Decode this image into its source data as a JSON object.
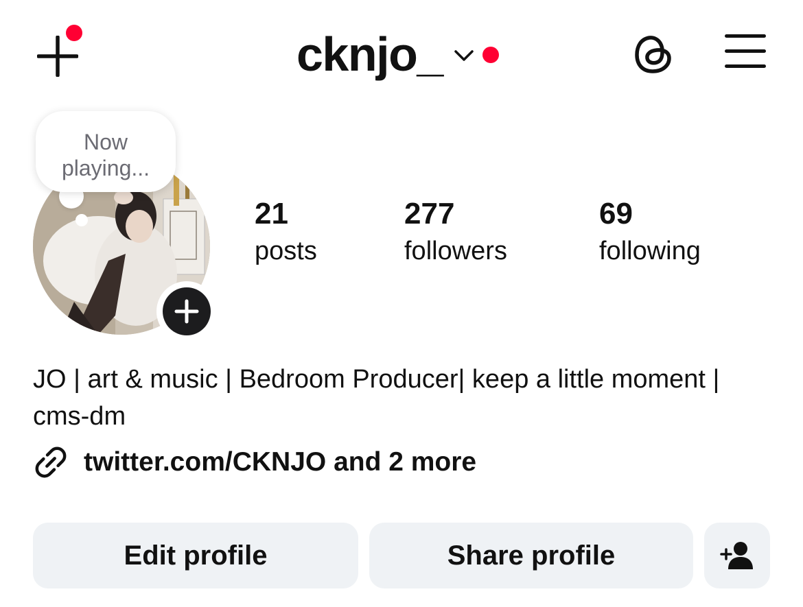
{
  "header": {
    "username": "cknjo_",
    "icons": {
      "new_post": "plus-icon",
      "account_switch": "chevron-down-icon",
      "threads": "threads-icon",
      "menu": "hamburger-menu-icon"
    },
    "notification_color": "#ff0033"
  },
  "note": {
    "text_line1": "Now",
    "text_line2": "playing..."
  },
  "avatar": {
    "add_story_icon": "plus-icon"
  },
  "stats": {
    "posts": {
      "count": "21",
      "label": "posts"
    },
    "followers": {
      "count": "277",
      "label": "followers"
    },
    "following": {
      "count": "69",
      "label": "following"
    }
  },
  "bio": {
    "text": "JO | art & music | Bedroom Producer| keep a little moment | cms-dm",
    "link_icon": "link-icon",
    "link_text": "twitter.com/CKNJO and 2 more"
  },
  "actions": {
    "edit_profile": "Edit profile",
    "share_profile": "Share profile",
    "discover_people_icon": "add-person-icon",
    "button_bg": "#eff2f5"
  }
}
